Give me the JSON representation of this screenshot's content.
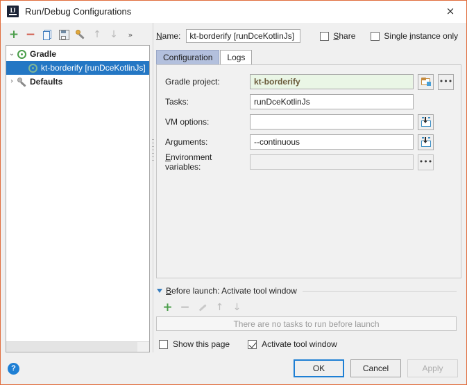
{
  "window": {
    "title": "Run/Debug Configurations",
    "app_icon": "intellij-idea-icon",
    "close_icon": "×"
  },
  "left_toolbar": {
    "items": [
      {
        "name": "add-configuration-button",
        "icon": "plus-icon",
        "glyph": "+",
        "enabled": true
      },
      {
        "name": "remove-configuration-button",
        "icon": "minus-icon",
        "glyph": "−",
        "enabled": true
      },
      {
        "name": "copy-configuration-button",
        "icon": "copy-icon",
        "glyph": "",
        "enabled": true
      },
      {
        "name": "save-configuration-button",
        "icon": "save-icon",
        "glyph": "",
        "enabled": true
      },
      {
        "name": "edit-defaults-button",
        "icon": "wrench-icon",
        "glyph": "",
        "enabled": true
      },
      {
        "name": "move-up-button",
        "icon": "arrow-up-icon",
        "glyph": "↑",
        "enabled": false
      },
      {
        "name": "move-down-button",
        "icon": "arrow-down-icon",
        "glyph": "↓",
        "enabled": false
      },
      {
        "name": "toolbar-overflow-button",
        "icon": "chevron-double-right-icon",
        "glyph": "»",
        "enabled": true
      }
    ]
  },
  "tree": {
    "nodes": [
      {
        "label": "Gradle",
        "twisty": "⌄",
        "expanded": true,
        "icon": "gradle-icon",
        "bold": true,
        "selected": false,
        "indent": 0
      },
      {
        "label": "kt-borderify [runDceKotlinJs]",
        "twisty": "",
        "expanded": false,
        "icon": "gradle-icon",
        "bold": false,
        "selected": true,
        "indent": 1
      },
      {
        "label": "Defaults",
        "twisty": "›",
        "expanded": false,
        "icon": "wrench-icon",
        "bold": true,
        "selected": false,
        "indent": 0
      }
    ]
  },
  "header": {
    "name_label_pre": "N",
    "name_label_post": "ame:",
    "name_value": "kt-borderify [runDceKotlinJs]",
    "name_placeholder": "",
    "share": {
      "label_pre": "S",
      "label_post": "hare",
      "checked": false
    },
    "single_instance": {
      "label_pre": "Single ",
      "label_mid": "i",
      "label_post": "nstance only",
      "checked": false
    }
  },
  "tabs": [
    {
      "label": "Configuration",
      "active": true
    },
    {
      "label": "Logs",
      "active": false
    }
  ],
  "form": {
    "rows": [
      {
        "label": "Gradle project:",
        "value": "kt-borderify",
        "style": "green",
        "button": "folder-icon",
        "button2": "ellipsis-icon",
        "disabled": false
      },
      {
        "label": "Tasks:",
        "value": "runDceKotlinJs",
        "style": "normal",
        "button": "",
        "button2": "",
        "disabled": false
      },
      {
        "label": "VM options:",
        "value": "",
        "style": "normal",
        "button": "expand-icon",
        "button2": "",
        "disabled": false
      },
      {
        "label": "Arguments:",
        "value": "--continuous",
        "style": "normal",
        "button": "expand-icon",
        "button2": "",
        "disabled": false
      },
      {
        "label": "Environment variables:",
        "label_underline_index": 0,
        "value": "",
        "style": "normal",
        "button": "ellipsis-icon",
        "button2": "",
        "disabled": true
      }
    ]
  },
  "before_launch": {
    "title_pre": "B",
    "title_post": "efore launch: Activate tool window",
    "collapse_icon": "triangle-down-icon",
    "toolbar": [
      {
        "name": "add-task-button",
        "icon": "plus-icon",
        "glyph": "+",
        "enabled": true
      },
      {
        "name": "remove-task-button",
        "icon": "minus-icon",
        "glyph": "−",
        "enabled": false
      },
      {
        "name": "edit-task-button",
        "icon": "pencil-icon",
        "glyph": "",
        "enabled": false
      },
      {
        "name": "task-move-up-button",
        "icon": "arrow-up-icon",
        "glyph": "↑",
        "enabled": false
      },
      {
        "name": "task-move-down-button",
        "icon": "arrow-down-icon",
        "glyph": "↓",
        "enabled": false
      }
    ],
    "empty_text": "There are no tasks to run before launch",
    "show_this_page": {
      "label": "Show this page",
      "checked": false
    },
    "activate_tool_window": {
      "label": "Activate tool window",
      "checked": true
    }
  },
  "footer": {
    "help_glyph": "?",
    "ok": "OK",
    "cancel": "Cancel",
    "apply": "Apply"
  },
  "colors": {
    "window_border": "#e06c3b",
    "selection_blue": "#2477c4",
    "tab_active": "#b3c0dd",
    "accent_green": "#4a9e4a",
    "accent_red": "#d05a4a",
    "focus_blue": "#1e7fd4",
    "field_green_bg": "#eaf6e6"
  }
}
